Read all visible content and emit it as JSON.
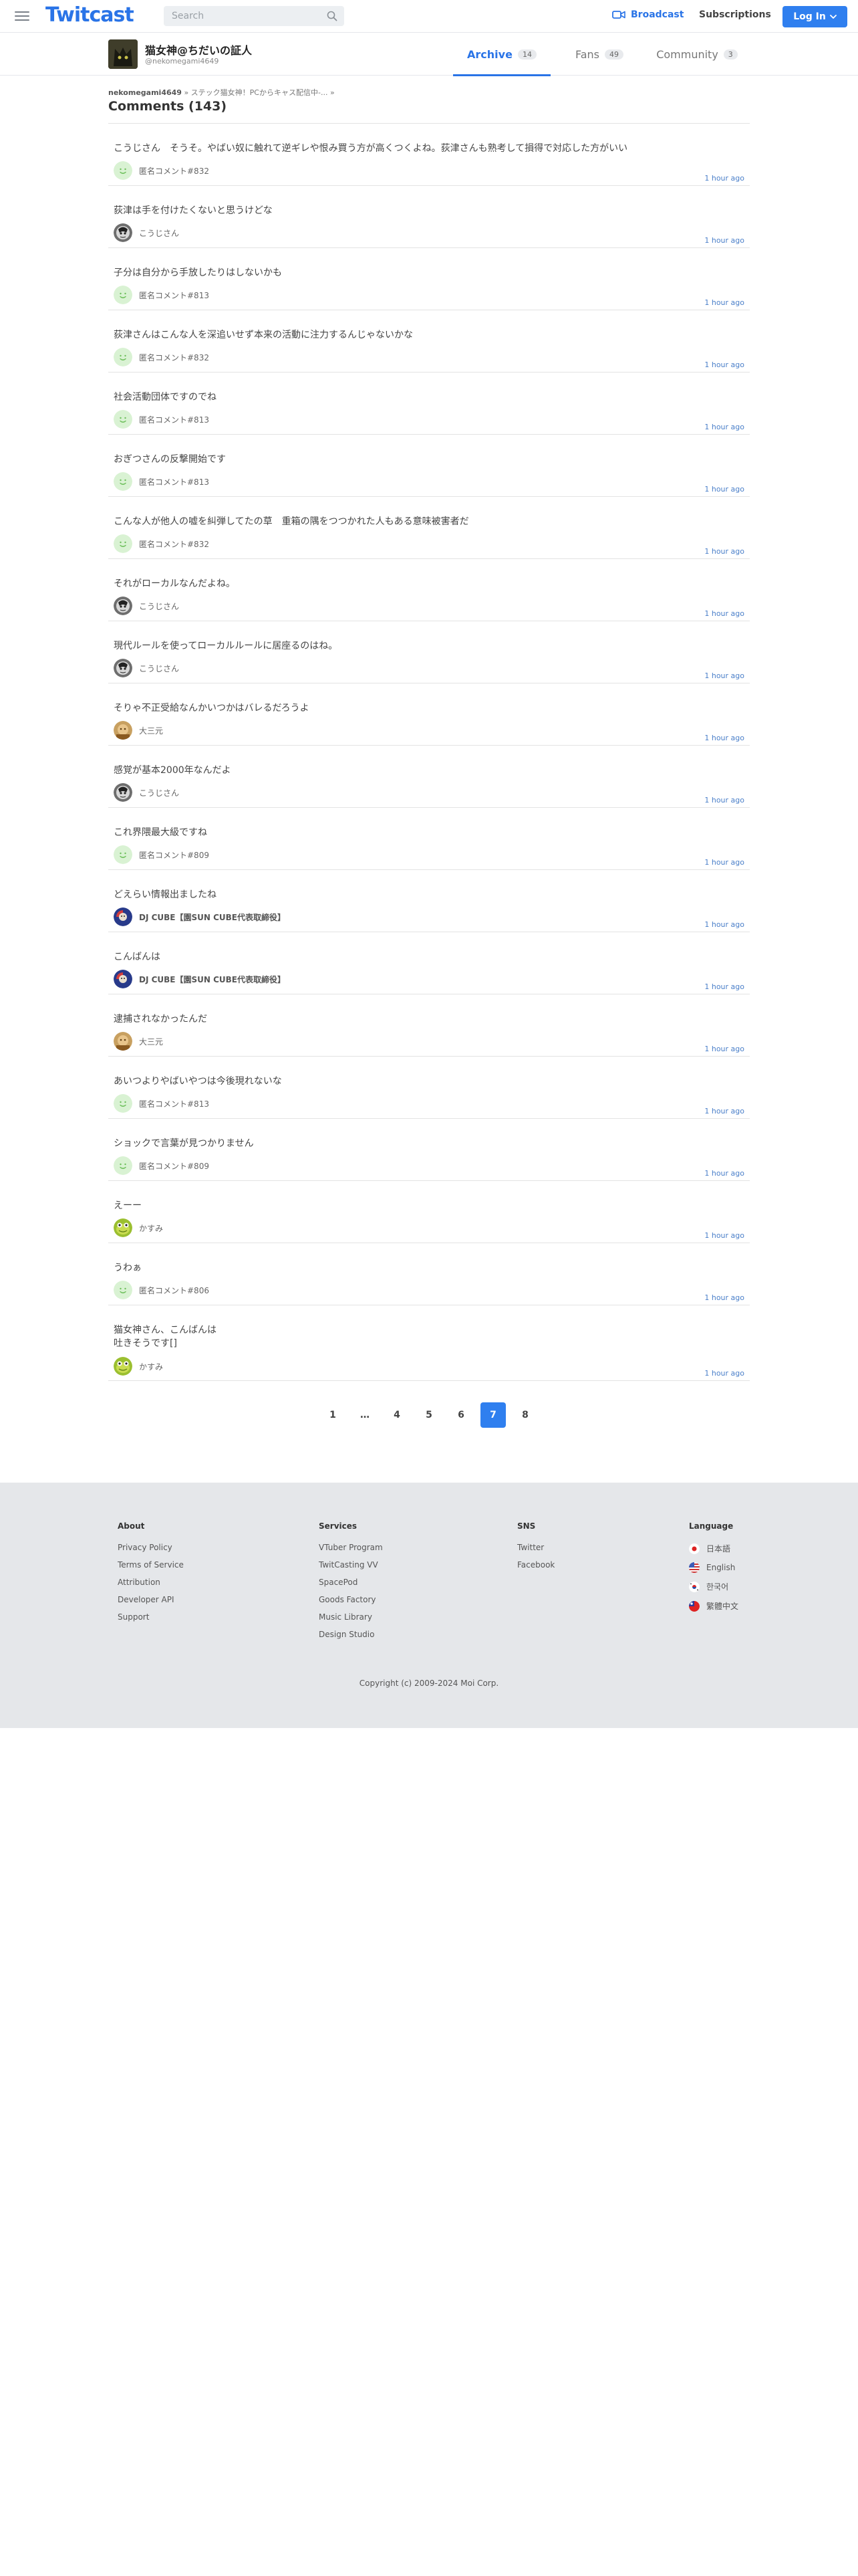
{
  "header": {
    "logo": "Twitcast",
    "search_placeholder": "Search",
    "broadcast_label": "Broadcast",
    "subscriptions_label": "Subscriptions",
    "login_label": "Log In"
  },
  "profile": {
    "name": "猫女神@ちだいの証人",
    "id": "@nekomegami4649",
    "tabs": [
      {
        "label": "Archive",
        "count": "14",
        "active": true
      },
      {
        "label": "Fans",
        "count": "49",
        "active": false
      },
      {
        "label": "Community",
        "count": "3",
        "active": false
      }
    ]
  },
  "breadcrumb": {
    "user": "nekomegami4649",
    "sep1": "»",
    "title": "ステック猫女神！PCからキャス配信中-...",
    "sep2": "»"
  },
  "page_title": "Comments (143)",
  "comments": [
    {
      "text": "こうじさん　そうそ。やばい奴に触れて逆ギレや恨み買う方が高くつくよね。荻津さんも熟考して損得で対応した方がいい",
      "author": "匿名コメント#832",
      "avatar": "anon",
      "time": "1 hour ago"
    },
    {
      "text": "荻津は手を付けたくないと思うけどな",
      "author": "こうじさん",
      "avatar": "kouji",
      "time": "1 hour ago"
    },
    {
      "text": "子分は自分から手放したりはしないかも",
      "author": "匿名コメント#813",
      "avatar": "anon",
      "time": "1 hour ago"
    },
    {
      "text": "荻津さんはこんな人を深追いせず本来の活動に注力するんじゃないかな",
      "author": "匿名コメント#832",
      "avatar": "anon",
      "time": "1 hour ago"
    },
    {
      "text": "社会活動団体ですのでね",
      "author": "匿名コメント#813",
      "avatar": "anon",
      "time": "1 hour ago"
    },
    {
      "text": "おぎつさんの反撃開始です",
      "author": "匿名コメント#813",
      "avatar": "anon",
      "time": "1 hour ago"
    },
    {
      "text": "こんな人が他人の嘘を糾弾してたの草　重箱の隅をつつかれた人もある意味被害者だ",
      "author": "匿名コメント#832",
      "avatar": "anon",
      "time": "1 hour ago"
    },
    {
      "text": "それがローカルなんだよね。",
      "author": "こうじさん",
      "avatar": "kouji",
      "time": "1 hour ago"
    },
    {
      "text": "現代ルールを使ってローカルルールに居座るのはね。",
      "author": "こうじさん",
      "avatar": "kouji",
      "time": "1 hour ago"
    },
    {
      "text": "そりゃ不正受給なんかいつかはバレるだろうよ",
      "author": "大三元",
      "avatar": "daisangen",
      "time": "1 hour ago"
    },
    {
      "text": "感覚が基本2000年なんだよ",
      "author": "こうじさん",
      "avatar": "kouji",
      "time": "1 hour ago"
    },
    {
      "text": "これ界隈最大級ですね",
      "author": "匿名コメント#809",
      "avatar": "anon",
      "time": "1 hour ago"
    },
    {
      "text": "どえらい情報出ましたね",
      "author": "DJ CUBE【園SUN CUBE代表取締役】",
      "avatar": "dj",
      "time": "1 hour ago"
    },
    {
      "text": "こんばんは",
      "author": "DJ CUBE【園SUN CUBE代表取締役】",
      "avatar": "dj",
      "time": "1 hour ago"
    },
    {
      "text": "逮捕されなかったんだ",
      "author": "大三元",
      "avatar": "daisangen",
      "time": "1 hour ago"
    },
    {
      "text": "あいつよりやばいやつは今後現れないな",
      "author": "匿名コメント#813",
      "avatar": "anon",
      "time": "1 hour ago"
    },
    {
      "text": "ショックで言葉が見つかりません",
      "author": "匿名コメント#809",
      "avatar": "anon",
      "time": "1 hour ago"
    },
    {
      "text": "えーー",
      "author": "かすみ",
      "avatar": "kasumi",
      "time": "1 hour ago"
    },
    {
      "text": "うわぁ",
      "author": "匿名コメント#806",
      "avatar": "anon",
      "time": "1 hour ago"
    },
    {
      "text": "猫女神さん、こんばんは\n吐きそうです[]",
      "author": "かすみ",
      "avatar": "kasumi",
      "time": "1 hour ago"
    }
  ],
  "pagination": {
    "pages": [
      "1",
      "…",
      "4",
      "5",
      "6",
      "7",
      "8"
    ],
    "current": "7"
  },
  "footer": {
    "about": {
      "heading": "About",
      "links": [
        "Privacy Policy",
        "Terms of Service",
        "Attribution",
        "Developer API",
        "Support"
      ]
    },
    "services": {
      "heading": "Services",
      "links": [
        "VTuber Program",
        "TwitCasting VV",
        "SpacePod",
        "Goods Factory",
        "Music Library",
        "Design Studio"
      ]
    },
    "sns": {
      "heading": "SNS",
      "links": [
        "Twitter",
        "Facebook"
      ]
    },
    "language": {
      "heading": "Language",
      "items": [
        {
          "label": "日本語",
          "flag": "jp"
        },
        {
          "label": "English",
          "flag": "us"
        },
        {
          "label": "한국어",
          "flag": "kr"
        },
        {
          "label": "繁體中文",
          "flag": "tw"
        }
      ]
    },
    "copyright": "Copyright (c) 2009-2024 Moi Corp."
  },
  "colors": {
    "brand": "#2a74e7",
    "login_button": "#2f7fef",
    "time_link": "#4a7fc9",
    "footer_bg": "#e5e7ea"
  }
}
